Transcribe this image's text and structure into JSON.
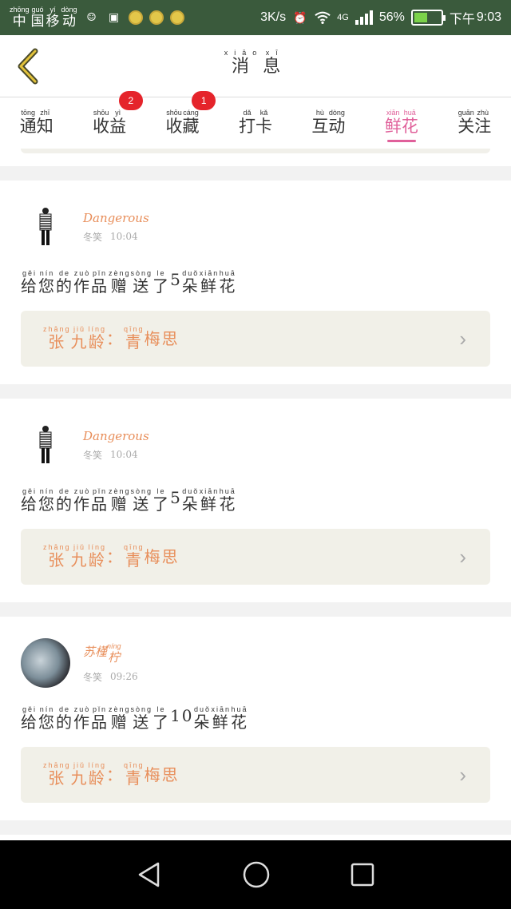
{
  "status_bar": {
    "carrier": [
      {
        "pinyin": "zhōng",
        "char": "中"
      },
      {
        "pinyin": "guó",
        "char": "国"
      },
      {
        "pinyin": "yí",
        "char": "移"
      },
      {
        "pinyin": "dòng",
        "char": "动"
      }
    ],
    "speed": "3K/s",
    "network": "4G",
    "battery": "56%",
    "battery_level": 0.56,
    "time_prefix": "下午",
    "time": "9:03"
  },
  "header": {
    "title": [
      {
        "pinyin": "xiāo",
        "char": "消"
      },
      {
        "pinyin": "xī",
        "char": "息"
      }
    ]
  },
  "tabs": [
    {
      "label": [
        {
          "pinyin": "tōng",
          "char": "通"
        },
        {
          "pinyin": "zhī",
          "char": "知"
        }
      ],
      "badge": null,
      "active": false
    },
    {
      "label": [
        {
          "pinyin": "shōu",
          "char": "收"
        },
        {
          "pinyin": "yì",
          "char": "益"
        }
      ],
      "badge": "2",
      "active": false
    },
    {
      "label": [
        {
          "pinyin": "shōu",
          "char": "收"
        },
        {
          "pinyin": "cáng",
          "char": "藏"
        }
      ],
      "badge": "1",
      "active": false
    },
    {
      "label": [
        {
          "pinyin": "dǎ",
          "char": "打"
        },
        {
          "pinyin": "kǎ",
          "char": "卡"
        }
      ],
      "badge": null,
      "active": false
    },
    {
      "label": [
        {
          "pinyin": "hù",
          "char": "互"
        },
        {
          "pinyin": "dòng",
          "char": "动"
        }
      ],
      "badge": null,
      "active": false
    },
    {
      "label": [
        {
          "pinyin": "xiān",
          "char": "鲜"
        },
        {
          "pinyin": "huā",
          "char": "花"
        }
      ],
      "badge": null,
      "active": true
    },
    {
      "label": [
        {
          "pinyin": "guān",
          "char": "关"
        },
        {
          "pinyin": "zhù",
          "char": "注"
        }
      ],
      "badge": null,
      "active": false
    }
  ],
  "items": [
    {
      "user": "Dangerous",
      "user_ruby": null,
      "role": "冬笑",
      "time": "10:04",
      "avatar": "figure",
      "message": [
        {
          "pinyin": "gěi",
          "char": "给"
        },
        {
          "pinyin": "nín",
          "char": "您"
        },
        {
          "pinyin": "de",
          "char": "的"
        },
        {
          "pinyin": "zuò",
          "char": "作"
        },
        {
          "pinyin": "pǐn",
          "char": "品"
        },
        {
          "pinyin": "zèng",
          "char": "赠"
        },
        {
          "pinyin": "sòng",
          "char": "送"
        },
        {
          "pinyin": "le",
          "char": "了"
        },
        {
          "pinyin": "",
          "char": "5"
        },
        {
          "pinyin": "duǒ",
          "char": "朵"
        },
        {
          "pinyin": "xiān",
          "char": "鲜"
        },
        {
          "pinyin": "huā",
          "char": "花"
        }
      ],
      "work": [
        {
          "pinyin": "zhāng",
          "char": "张"
        },
        {
          "pinyin": "jiǔ",
          "char": "九"
        },
        {
          "pinyin": "líng",
          "char": "龄"
        },
        {
          "pinyin": "",
          "char": "："
        },
        {
          "pinyin": "qīng",
          "char": "青"
        },
        {
          "pinyin": "",
          "char": "梅"
        },
        {
          "pinyin": "",
          "char": "思"
        }
      ]
    },
    {
      "user": "Dangerous",
      "user_ruby": null,
      "role": "冬笑",
      "time": "10:04",
      "avatar": "figure",
      "message": [
        {
          "pinyin": "gěi",
          "char": "给"
        },
        {
          "pinyin": "nín",
          "char": "您"
        },
        {
          "pinyin": "de",
          "char": "的"
        },
        {
          "pinyin": "zuò",
          "char": "作"
        },
        {
          "pinyin": "pǐn",
          "char": "品"
        },
        {
          "pinyin": "zèng",
          "char": "赠"
        },
        {
          "pinyin": "sòng",
          "char": "送"
        },
        {
          "pinyin": "le",
          "char": "了"
        },
        {
          "pinyin": "",
          "char": "5"
        },
        {
          "pinyin": "duǒ",
          "char": "朵"
        },
        {
          "pinyin": "xiān",
          "char": "鲜"
        },
        {
          "pinyin": "huā",
          "char": "花"
        }
      ],
      "work": [
        {
          "pinyin": "zhāng",
          "char": "张"
        },
        {
          "pinyin": "jiǔ",
          "char": "九"
        },
        {
          "pinyin": "líng",
          "char": "龄"
        },
        {
          "pinyin": "",
          "char": "："
        },
        {
          "pinyin": "qīng",
          "char": "青"
        },
        {
          "pinyin": "",
          "char": "梅"
        },
        {
          "pinyin": "",
          "char": "思"
        }
      ]
    },
    {
      "user": "",
      "user_ruby": [
        {
          "pinyin": "",
          "char": "苏"
        },
        {
          "pinyin": "",
          "char": "槿"
        },
        {
          "pinyin": "níng",
          "char": "柠"
        }
      ],
      "role": "冬笑",
      "time": "09:26",
      "avatar": "photo",
      "message": [
        {
          "pinyin": "gěi",
          "char": "给"
        },
        {
          "pinyin": "nín",
          "char": "您"
        },
        {
          "pinyin": "de",
          "char": "的"
        },
        {
          "pinyin": "zuò",
          "char": "作"
        },
        {
          "pinyin": "pǐn",
          "char": "品"
        },
        {
          "pinyin": "zèng",
          "char": "赠"
        },
        {
          "pinyin": "sòng",
          "char": "送"
        },
        {
          "pinyin": "le",
          "char": "了"
        },
        {
          "pinyin": "",
          "char": "10"
        },
        {
          "pinyin": "duǒ",
          "char": "朵"
        },
        {
          "pinyin": "xiān",
          "char": "鲜"
        },
        {
          "pinyin": "huā",
          "char": "花"
        }
      ],
      "work": [
        {
          "pinyin": "zhāng",
          "char": "张"
        },
        {
          "pinyin": "jiǔ",
          "char": "九"
        },
        {
          "pinyin": "líng",
          "char": "龄"
        },
        {
          "pinyin": "",
          "char": "："
        },
        {
          "pinyin": "qīng",
          "char": "青"
        },
        {
          "pinyin": "",
          "char": "梅"
        },
        {
          "pinyin": "",
          "char": "思"
        }
      ]
    }
  ],
  "colors": {
    "accent": "#e0609a",
    "name": "#e88e5a",
    "badge": "#e5242b",
    "status_bar": "#3a5a3c"
  },
  "icons": {
    "back": "back-chevron-icon",
    "chevron": "chevron-right-icon",
    "nav_back": "nav-back-icon",
    "nav_home": "nav-home-icon",
    "nav_recent": "nav-recent-icon"
  }
}
